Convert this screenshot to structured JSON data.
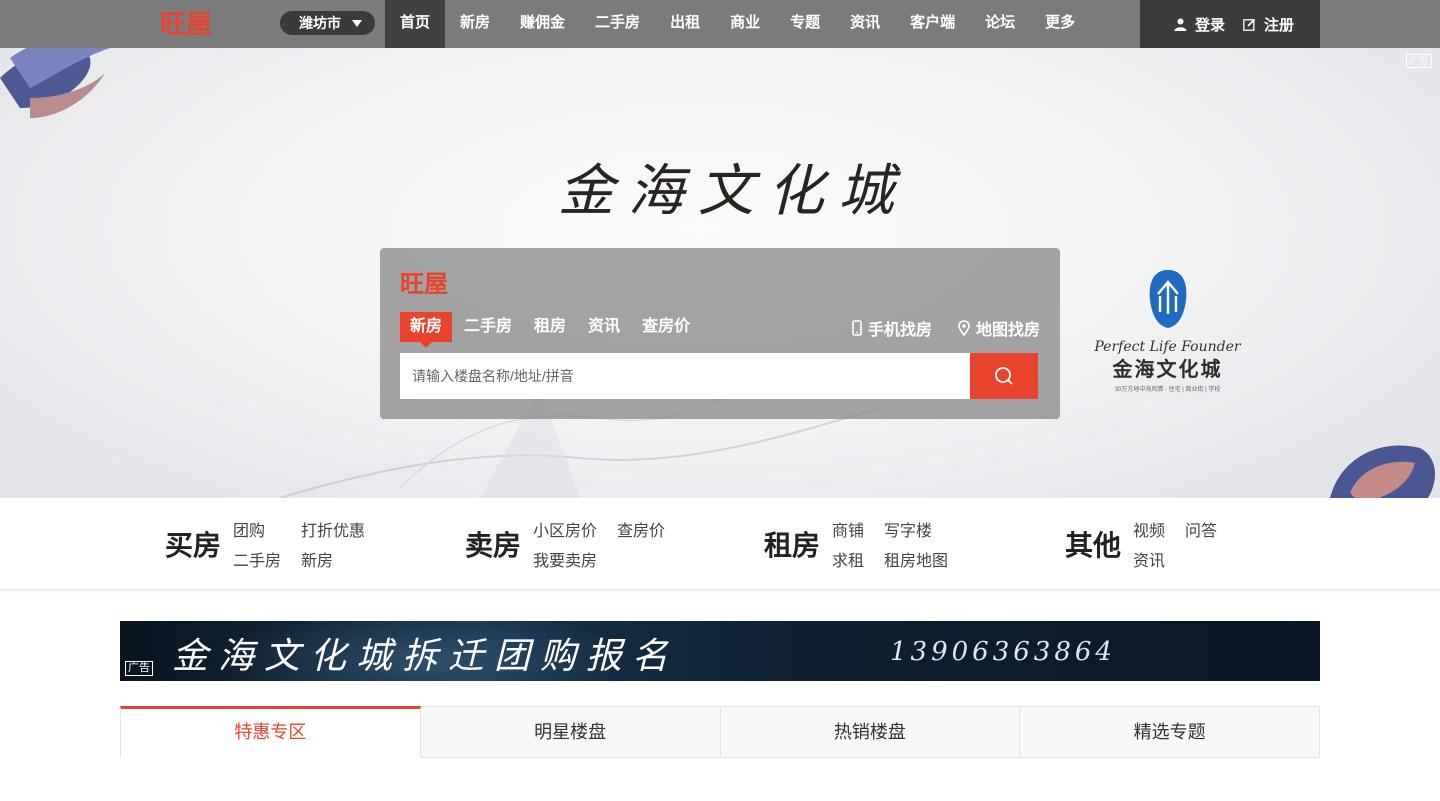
{
  "topbar": {
    "logo_text": "旺屋",
    "city": "潍坊市",
    "nav": [
      "首页",
      "新房",
      "赚佣金",
      "二手房",
      "出租",
      "商业",
      "专题",
      "资讯",
      "客户端",
      "论坛",
      "更多"
    ],
    "login": "登录",
    "register": "注册"
  },
  "hero": {
    "ad_tag": "广告",
    "slogan": "金海文化城",
    "search": {
      "logo_text": "旺屋",
      "tabs": [
        "新房",
        "二手房",
        "租房",
        "资讯",
        "查房价"
      ],
      "mobile_link": "手机找房",
      "map_link": "地图找房",
      "placeholder": "请输入楼盘名称/地址/拼音"
    },
    "brand": {
      "en": "Perfect Life Founder",
      "cn": "金海文化城",
      "sub": "30万方地中海风情 · 住宅 | 商业街 | 学校"
    }
  },
  "quick": [
    {
      "head": "买房",
      "links": [
        "团购",
        "打折优惠",
        "二手房",
        "新房"
      ]
    },
    {
      "head": "卖房",
      "links": [
        "小区房价",
        "查房价",
        "我要卖房"
      ]
    },
    {
      "head": "租房",
      "links": [
        "商铺",
        "写字楼",
        "求租",
        "租房地图"
      ]
    },
    {
      "head": "其他",
      "links": [
        "视频",
        "问答",
        "资讯"
      ]
    }
  ],
  "banner": {
    "text": "金海文化城拆迁团购报名",
    "phone": "13906363864",
    "ad_tag": "广告"
  },
  "tabs": [
    "特惠专区",
    "明星楼盘",
    "热销楼盘",
    "精选专题"
  ],
  "colors": {
    "accent": "#e8432d",
    "topbar": "#7b7b7b",
    "topbar_dark": "#3c3c3c"
  }
}
